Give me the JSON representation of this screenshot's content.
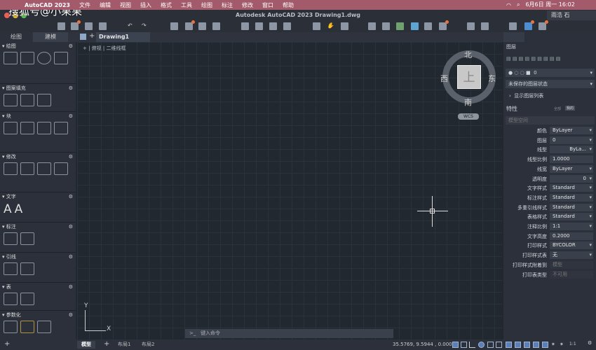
{
  "watermark": "搜狐号@小果果",
  "menubar": {
    "app": "AutoCAD 2023",
    "items": [
      "文件",
      "编辑",
      "视图",
      "插入",
      "格式",
      "工具",
      "绘图",
      "标注",
      "修改",
      "窗口",
      "帮助"
    ],
    "clock": "6月6日 周一 16:02"
  },
  "titlebar": {
    "title": "Autodesk AutoCAD 2023   Drawing1.dwg",
    "user": "雨浩 石"
  },
  "palette": {
    "tabs": [
      "绘图",
      "建模"
    ],
    "sections": [
      "绘图",
      "图案填充",
      "块",
      "修改",
      "文字",
      "标注",
      "引线",
      "表",
      "参数化"
    ]
  },
  "document_tab": "Drawing1",
  "viewport": {
    "label": "[-] [俯视] [二维线框]",
    "labels": [
      "+",
      "俯视",
      "二维线框"
    ]
  },
  "viewcube": {
    "top": "上",
    "north": "北",
    "south": "南",
    "east": "东",
    "west": "西",
    "wcs": "WCS"
  },
  "ucs": {
    "x": "X",
    "y": "Y"
  },
  "command": {
    "placeholder": "键入命令",
    "prompt": ">_"
  },
  "layers": {
    "title": "图层",
    "current": "0",
    "state": "未保存的图层状态",
    "show_list": "显示图层列表"
  },
  "properties": {
    "title": "特性",
    "tabs": [
      "全部",
      "我的"
    ],
    "space": "模型空间",
    "rows": [
      {
        "label": "颜色",
        "value": "ByLayer"
      },
      {
        "label": "图层",
        "value": "0"
      },
      {
        "label": "线型",
        "value": "ByLa..."
      },
      {
        "label": "线型比例",
        "value": "1.0000"
      },
      {
        "label": "线宽",
        "value": "ByLayer"
      },
      {
        "label": "透明度",
        "value": "0"
      },
      {
        "label": "文字样式",
        "value": "Standard"
      },
      {
        "label": "标注样式",
        "value": "Standard"
      },
      {
        "label": "多重引线样式",
        "value": "Standard"
      },
      {
        "label": "表格样式",
        "value": "Standard"
      },
      {
        "label": "注释比例",
        "value": "1:1"
      },
      {
        "label": "文字高度",
        "value": "0.2000"
      },
      {
        "label": "打印样式",
        "value": "BYCOLOR"
      },
      {
        "label": "打印样式表",
        "value": "无"
      },
      {
        "label": "打印样式附着到",
        "value": "模型"
      },
      {
        "label": "打印表类型",
        "value": "不可用"
      }
    ]
  },
  "status": {
    "tabs": [
      "模型",
      "布局1",
      "布局2"
    ],
    "coords": "35.5769, 9.5944 , 0.0000",
    "scale": "1:1"
  }
}
